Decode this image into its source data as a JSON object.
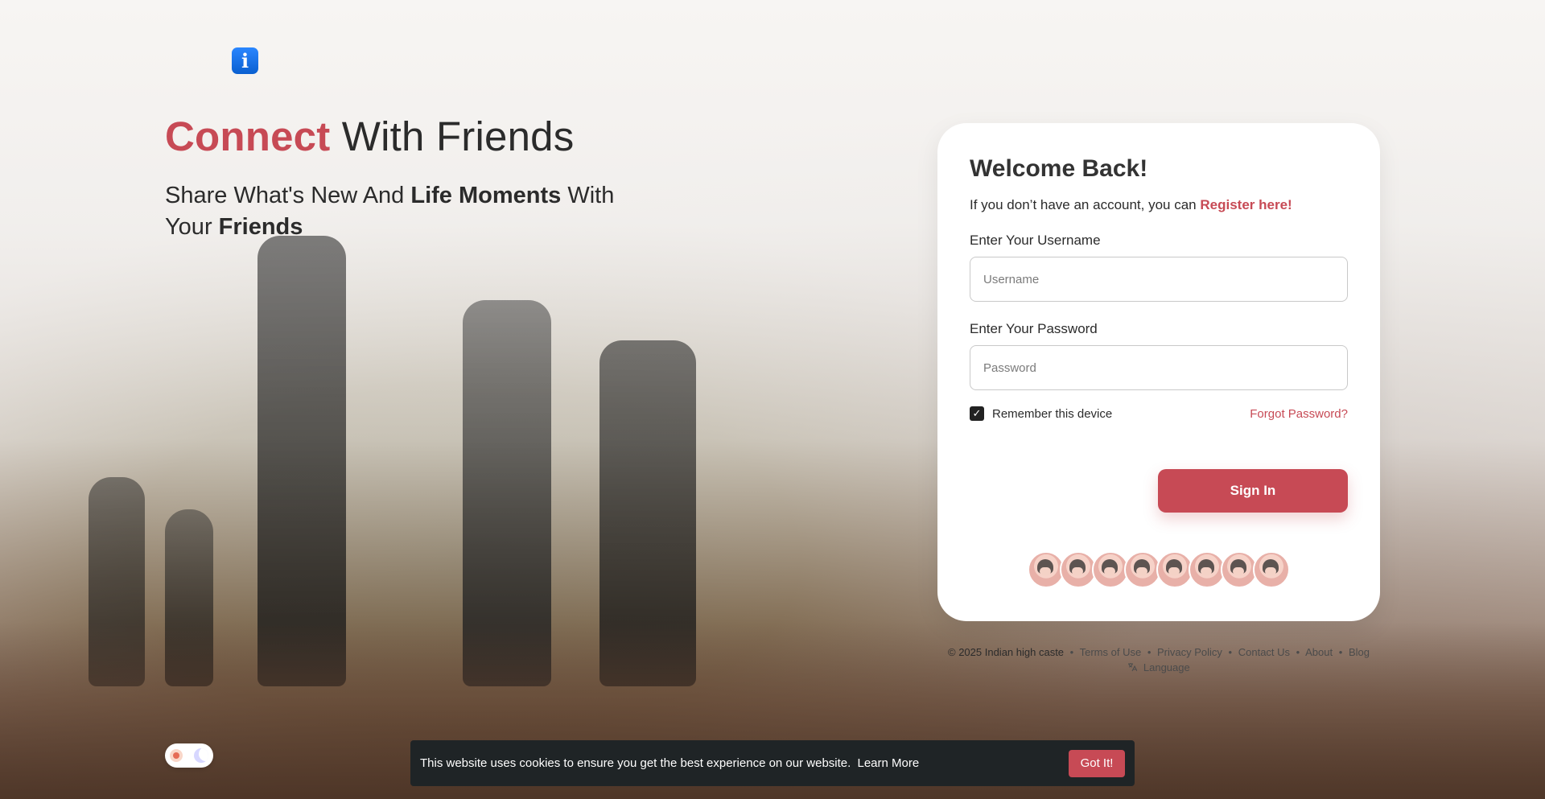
{
  "brand": {
    "logo_letter": "i"
  },
  "hero": {
    "title_prefix": "Connect",
    "title_suffix": "With Friends",
    "subtitle_part1": "Share What's New And ",
    "subtitle_bold1": "Life Moments",
    "subtitle_part2": " With",
    "subtitle_part3": "Your ",
    "subtitle_bold2": "Friends"
  },
  "login": {
    "title": "Welcome Back! ",
    "register_prefix": "If you don’t have an account, you can ",
    "register_link": "Register here!",
    "username_label": "Enter Your Username",
    "username_placeholder": "Username",
    "password_label": "Enter Your Password",
    "password_placeholder": "Password",
    "remember_label": "Remember this device",
    "remember_checked": true,
    "forgot_link": "Forgot Password?",
    "signin_button": "Sign In"
  },
  "avatars": {
    "count": 8
  },
  "footer": {
    "copyright": "© 2025 Indian high caste",
    "links": [
      "Terms of Use",
      "Privacy Policy",
      "Contact Us",
      "About",
      "Blog"
    ],
    "language": "Language"
  },
  "cookie": {
    "message": "This website uses cookies to ensure you get the best experience on our website.",
    "learn_more": "Learn More",
    "button": "Got It!"
  },
  "colors": {
    "accent": "#c74a55",
    "cookie_bg": "#1f2426",
    "logo_blue": "#0a5fd0"
  }
}
